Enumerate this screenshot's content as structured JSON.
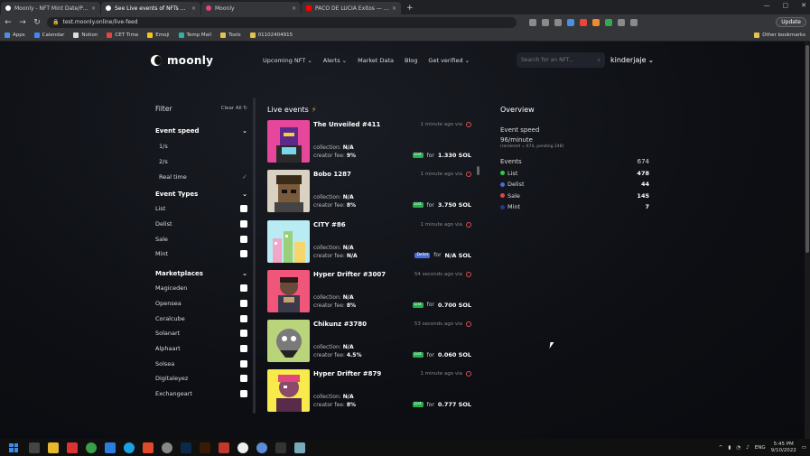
{
  "browser": {
    "tabs": [
      {
        "title": "Moonly - NFT Mint Date/Price",
        "active": false,
        "icon_color": "#ffffff"
      },
      {
        "title": "See Live events of NFTs being li...",
        "active": true,
        "icon_color": "#ffffff"
      },
      {
        "title": "Moonly",
        "active": false,
        "icon_color": "#e0457b"
      },
      {
        "title": "PACO DE LUCIA Exitos — Bes...",
        "active": false,
        "icon_color": "#ff0000"
      }
    ],
    "new_tab_glyph": "+",
    "url": "test.moonly.online/live-feed",
    "update_label": "Update",
    "bookmarks": [
      "Apps",
      "Calendar",
      "Notion",
      "CET Time",
      "Emoji",
      "Temp Mail",
      "Tools",
      "01102404915"
    ],
    "other_bookmarks": "Other bookmarks"
  },
  "site": {
    "brand": "moonly",
    "nav": [
      {
        "label": "Upcoming NFT",
        "dropdown": true
      },
      {
        "label": "Alerts",
        "dropdown": true
      },
      {
        "label": "Market Data",
        "dropdown": false
      },
      {
        "label": "Blog",
        "dropdown": false
      },
      {
        "label": "Get verified",
        "dropdown": true
      }
    ],
    "search_placeholder": "Search for an NFT...",
    "username": "kinderjaje"
  },
  "filter": {
    "title": "Filter",
    "clear_all": "Clear All",
    "event_speed": {
      "title": "Event speed",
      "options": [
        {
          "label": "1/s",
          "selected": false
        },
        {
          "label": "2/s",
          "selected": false
        },
        {
          "label": "Real time",
          "selected": true
        }
      ]
    },
    "event_types": {
      "title": "Event Types",
      "options": [
        "List",
        "Delist",
        "Sale",
        "Mint"
      ]
    },
    "marketplaces": {
      "title": "Marketplaces",
      "options": [
        "Magiceden",
        "Opensea",
        "Coralcube",
        "Solanart",
        "Alphaart",
        "Solsea",
        "Digitaleyez",
        "Exchangeart"
      ]
    }
  },
  "feed": {
    "title": "Live events",
    "events": [
      {
        "name": "The Unveiled #411",
        "time": "1 minute ago via",
        "collection": "N/A",
        "fee": "9%",
        "type": "List",
        "price": "1.330 SOL",
        "art": "unveiled"
      },
      {
        "name": "Bobo 1287",
        "time": "1 minute ago via",
        "collection": "N/A",
        "fee": "8%",
        "type": "List",
        "price": "3.750 SOL",
        "art": "bobo"
      },
      {
        "name": "CITY #86",
        "time": "1 minute ago via",
        "collection": "N/A",
        "fee": "N/A",
        "type": "Delist",
        "price": "N/A SOL",
        "art": "city"
      },
      {
        "name": "Hyper Drifter #3007",
        "time": "54 seconds ago via",
        "collection": "N/A",
        "fee": "8%",
        "type": "List",
        "price": "0.700 SOL",
        "art": "drifter"
      },
      {
        "name": "Chikunz #3780",
        "time": "53 seconds ago via",
        "collection": "N/A",
        "fee": "4.5%",
        "type": "List",
        "price": "0.060 SOL",
        "art": "chikunz"
      },
      {
        "name": "Hyper Drifter #879",
        "time": "1 minute ago via",
        "collection": "N/A",
        "fee": "8%",
        "type": "List",
        "price": "0.777 SOL",
        "art": "drifter2"
      }
    ],
    "collection_label": "collection:",
    "fee_label": "creator fee:",
    "for_label": "for"
  },
  "overview": {
    "title": "Overview",
    "speed_label": "Event speed",
    "rate": "96/minute",
    "rendered": "(rendered = 674, pending 248)",
    "events_label": "Events",
    "events_total": "674",
    "rows": [
      {
        "label": "List",
        "value": "478",
        "color": "#2ecc40"
      },
      {
        "label": "Delist",
        "value": "44",
        "color": "#4b6bd6"
      },
      {
        "label": "Sale",
        "value": "145",
        "color": "#e64545"
      },
      {
        "label": "Mint",
        "value": "7",
        "color": "#223a8a"
      }
    ]
  },
  "taskbar": {
    "lang": "ENG",
    "time": "5:45 PM",
    "date": "9/10/2022"
  }
}
